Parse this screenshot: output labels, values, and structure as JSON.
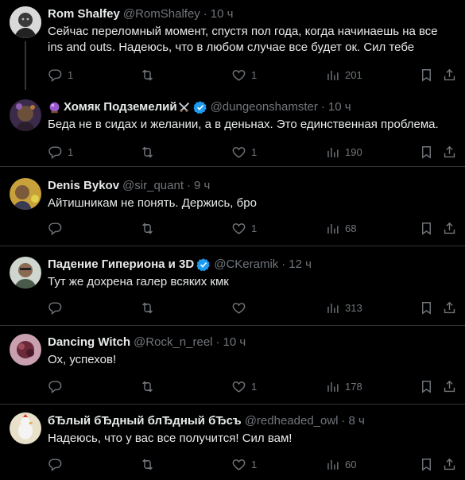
{
  "feed": {
    "tweets": [
      {
        "name": "Rom Shalfey",
        "handle": "@RomShalfey",
        "time": "10 ч",
        "text": "Сейчас переломный момент, спустя пол года, когда начинаешь на все ins and outs. Надеюсь, что в любом случае все будет ок. Сил тебе",
        "replies": "1",
        "likes": "1",
        "views": "201"
      },
      {
        "name": "Хомяк Подземелий",
        "handle": "@dungeonshamster",
        "time": "10 ч",
        "text": "Беда не в сидах и желании, а в деньнах. Это единственная проблема.",
        "replies": "1",
        "likes": "1",
        "views": "190"
      },
      {
        "name": "Denis Bykov",
        "handle": "@sir_quant",
        "time": "9 ч",
        "text": "Айтишникам не понять. Держись, бро",
        "replies": "",
        "likes": "1",
        "views": "68"
      },
      {
        "name": "Падение Гипериона и 3D",
        "handle": "@CKeramik",
        "time": "12 ч",
        "text": "Тут же дохрена галер всяких кмк",
        "replies": "",
        "likes": "",
        "views": "313"
      },
      {
        "name": "Dancing Witch",
        "handle": "@Rock_n_reel",
        "time": "10 ч",
        "text": "Ох, успехов!",
        "replies": "",
        "likes": "1",
        "views": "178"
      },
      {
        "name": "бЂлый бЂдный блЂдный бЂсъ",
        "handle": "@redheaded_owl",
        "time": "8 ч",
        "text": "Надеюсь, что у вас все получится! Сил вам!",
        "replies": "",
        "likes": "1",
        "views": "60"
      }
    ],
    "separator_dot": "·",
    "colors": {
      "background": "#000000",
      "text": "#e7e9ea",
      "secondary": "#71767b",
      "verified": "#1d9bf0",
      "divider": "#2f3336"
    },
    "icons": [
      "reply-icon",
      "retweet-icon",
      "like-icon",
      "views-icon",
      "bookmark-icon",
      "share-icon",
      "verified-icon",
      "crystal-ball-icon",
      "crossed-swords-icon"
    ]
  }
}
